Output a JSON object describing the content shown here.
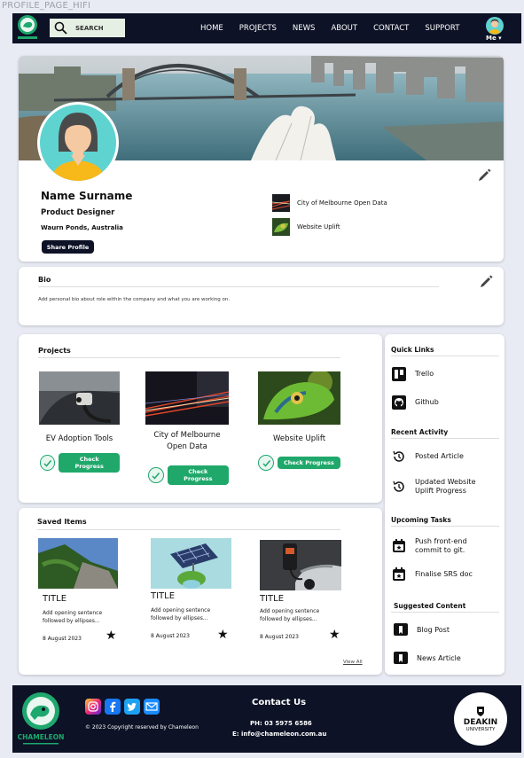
{
  "frame_label": "PROFILE_PAGE_HIFI",
  "nav": {
    "search_label": "SEARCH",
    "menu": [
      "HOME",
      "PROJECTS",
      "NEWS",
      "ABOUT",
      "CONTACT",
      "SUPPORT"
    ],
    "user_label": "Me ▾"
  },
  "profile": {
    "name": "Name Surname",
    "role": "Product Designer",
    "location": "Waurn Ponds, Australia",
    "share_label": "Share Profile",
    "linked_projects": [
      "City of Melbourne Open Data",
      "Website Uplift"
    ]
  },
  "bio": {
    "title": "Bio",
    "text": "Add personal bio about role within the company and what you are working on."
  },
  "projects": {
    "title": "Projects",
    "button_label": "Check Progress",
    "items": [
      {
        "title": "EV Adoption Tools"
      },
      {
        "title_line1": "City of Melbourne",
        "title_line2": "Open Data"
      },
      {
        "title": "Website Uplift"
      }
    ]
  },
  "saved": {
    "title": "Saved Items",
    "view_all": "View All",
    "items": [
      {
        "title": "TITLE",
        "desc_line1": "Add opening sentence",
        "desc_line2": "followed by ellipses...",
        "date": "8 August 2023"
      },
      {
        "title": "TITLE",
        "desc_line1": "Add opening sentence",
        "desc_line2": "followed by ellipses...",
        "date": "8 August 2023"
      },
      {
        "title": "TITLE",
        "desc_line1": "Add opening sentence",
        "desc_line2": "followed by ellipses...",
        "date": "8 August 2023"
      }
    ]
  },
  "sidebar": {
    "quick_links": {
      "title": "Quick Links",
      "items": [
        "Trello",
        "Github"
      ]
    },
    "recent": {
      "title": "Recent Activity",
      "items": [
        {
          "line1": "Posted Article"
        },
        {
          "line1": "Updated Website",
          "line2": "Uplift Progress"
        }
      ]
    },
    "tasks": {
      "title": "Upcoming Tasks",
      "items": [
        {
          "line1": "Push front-end",
          "line2": "commit to git."
        },
        {
          "line1": "Finalise SRS doc"
        }
      ]
    },
    "suggested": {
      "title": "Suggested Content",
      "items": [
        "Blog Post",
        "News Article"
      ]
    }
  },
  "footer": {
    "brand": "CHAMELEON",
    "copyright": "© 2023 Copyright reserved by Chameleon",
    "contact_title": "Contact Us",
    "phone": "PH: 03 5975 6586",
    "email": "E: info@chameleon.com.au",
    "partner_line1": "DEAKIN",
    "partner_line2": "UNIVERSITY"
  },
  "colors": {
    "navy": "#0d1226",
    "green": "#20a86b",
    "avatar_bg": "#5fd3d0"
  },
  "icons": [
    "search-icon",
    "pencil-icon",
    "check-circle-icon",
    "star-icon",
    "trello-icon",
    "github-icon",
    "history-icon",
    "calendar-icon",
    "bookmark-icon",
    "instagram-icon",
    "facebook-icon",
    "twitter-icon",
    "mail-icon"
  ]
}
